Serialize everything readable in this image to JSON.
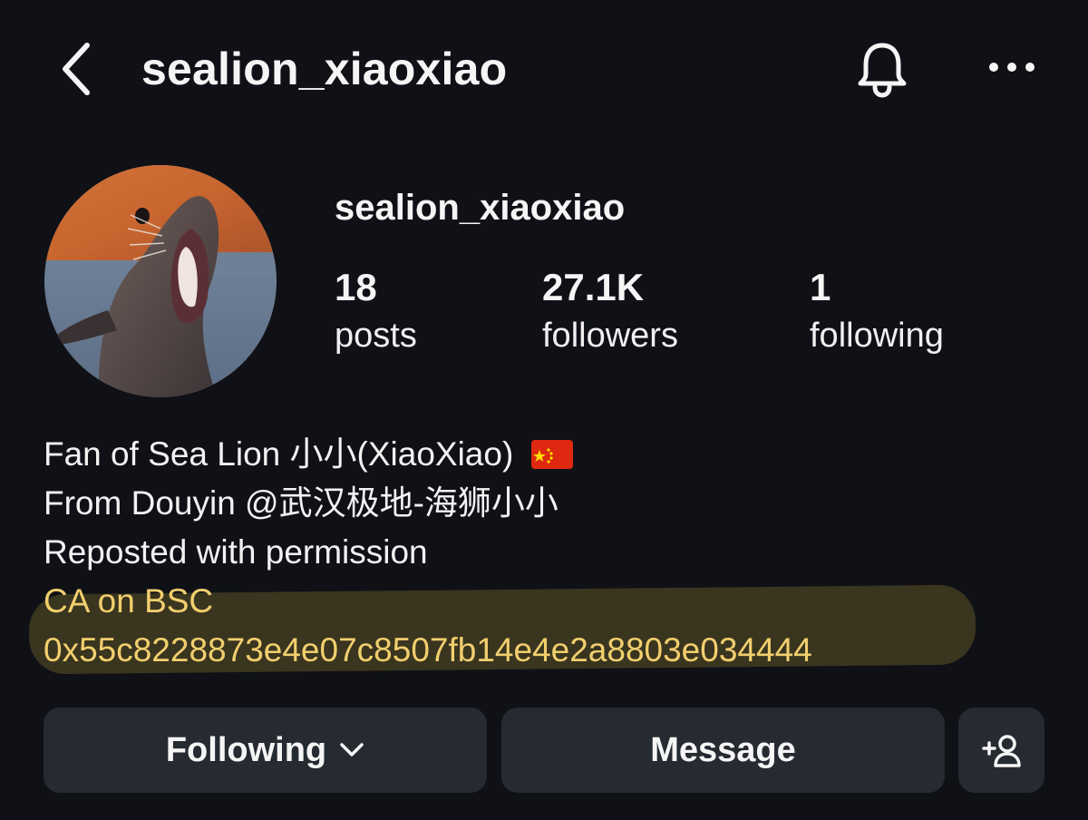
{
  "header": {
    "back_icon": "chevron-left-icon",
    "title": "sealion_xiaoxiao",
    "bell_icon": "bell-icon",
    "more_icon": "more-horizontal-icon"
  },
  "profile": {
    "avatar_icon": "avatar",
    "name": "sealion_xiaoxiao",
    "stats": {
      "posts": {
        "value": "18",
        "label": "posts"
      },
      "followers": {
        "value": "27.1K",
        "label": "followers"
      },
      "following": {
        "value": "1",
        "label": "following"
      }
    }
  },
  "bio": {
    "line1": "Fan of Sea Lion 小小(XiaoXiao)",
    "line2": "From Douyin @武汉极地-海狮小小",
    "line3": "Reposted with permission",
    "line4": "CA on BSC",
    "line5": "0x55c8228873e4e07c8507fb14e4e2a8803e034444",
    "flag_icon": "china-flag-icon",
    "link_color": "#f2cf6e",
    "highlight_color": "#d6b742"
  },
  "actions": {
    "following_label": "Following",
    "message_label": "Message",
    "add_user_icon": "add-user-icon"
  },
  "colors": {
    "background": "#0f1116",
    "button_bg": "#262a31",
    "text": "#f5f5f5"
  }
}
